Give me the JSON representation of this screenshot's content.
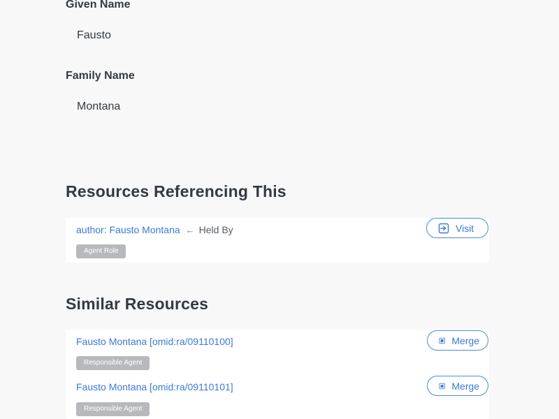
{
  "person": {
    "given_name_label": "Given Name",
    "given_name_value": "Fausto",
    "family_name_label": "Family Name",
    "family_name_value": "Montana"
  },
  "referencing": {
    "title": "Resources Referencing This",
    "items": [
      {
        "link_text": "author: Fausto Montana",
        "arrow": "←",
        "relation": "Held By",
        "badge": "Agent Role",
        "button_label": "Visit",
        "button_icon": "enter-icon"
      }
    ]
  },
  "similar": {
    "title": "Similar Resources",
    "items": [
      {
        "link_text": "Fausto Montana [omid:ra/09110100]",
        "badge": "Responsible Agent",
        "button_label": "Merge",
        "button_icon": "merge-icon"
      },
      {
        "link_text": "Fausto Montana [omid:ra/09110101]",
        "badge": "Responsible Agent",
        "button_label": "Merge",
        "button_icon": "merge-icon"
      }
    ]
  },
  "colors": {
    "link": "#3a7bd5",
    "badge": "#b7b9bc",
    "button_border": "#4a8ad9",
    "background": "#f8f8f9"
  }
}
